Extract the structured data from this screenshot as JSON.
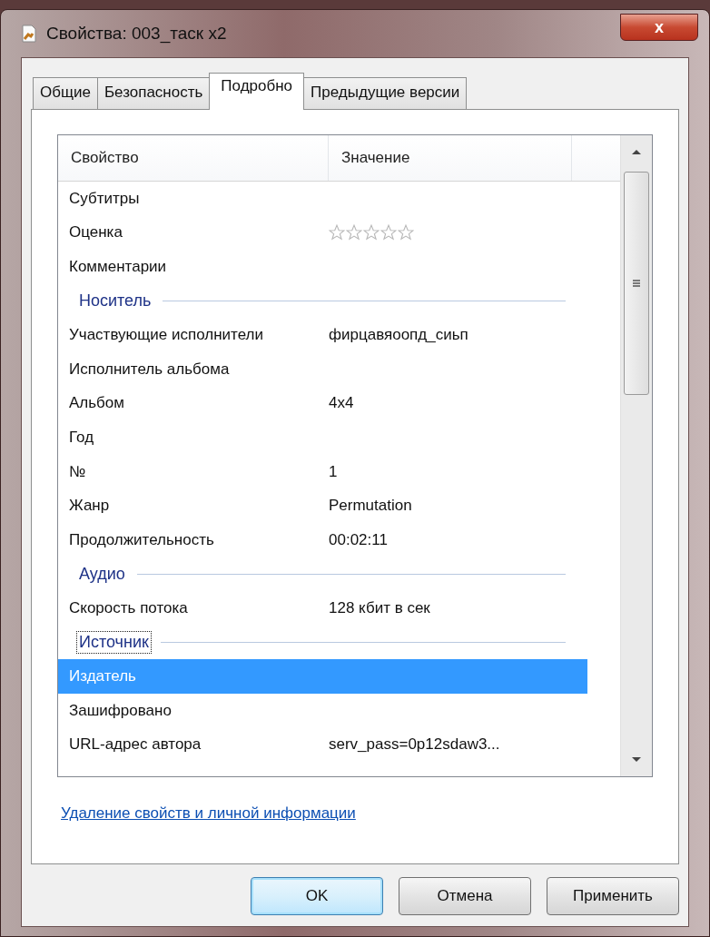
{
  "window": {
    "title": "Свойства: 003_таск x2",
    "close": "x"
  },
  "tabs": [
    {
      "label": "Общие",
      "selected": false
    },
    {
      "label": "Безопасность",
      "selected": false
    },
    {
      "label": "Подробно",
      "selected": true
    },
    {
      "label": "Предыдущие версии",
      "selected": false
    }
  ],
  "table": {
    "columns": [
      "Свойство",
      "Значение"
    ],
    "rows": [
      {
        "kind": "property",
        "name": "Субтитры",
        "selected": false
      },
      {
        "kind": "property",
        "name": "Оценка",
        "stars": 0,
        "selected": false
      },
      {
        "kind": "property",
        "name": "Комментарии",
        "selected": false
      },
      {
        "kind": "group",
        "label": "Носитель",
        "focused": false
      },
      {
        "kind": "property",
        "name": "Участвующие исполнители",
        "value": "фирцавяоопд_сиьп",
        "selected": false
      },
      {
        "kind": "property",
        "name": "Исполнитель альбома",
        "selected": false
      },
      {
        "kind": "property",
        "name": "Альбом",
        "value": "4x4",
        "selected": false
      },
      {
        "kind": "property",
        "name": "Год",
        "selected": false
      },
      {
        "kind": "property",
        "name": "№",
        "value": "1",
        "selected": false
      },
      {
        "kind": "property",
        "name": "Жанр",
        "value": "Permutation",
        "selected": false
      },
      {
        "kind": "property",
        "name": "Продолжительность",
        "value": "00:02:11",
        "selected": false
      },
      {
        "kind": "group",
        "label": "Аудио",
        "focused": false
      },
      {
        "kind": "property",
        "name": "Скорость потока",
        "value": "128 кбит в сек",
        "selected": false
      },
      {
        "kind": "group",
        "label": "Источник",
        "focused": true
      },
      {
        "kind": "property",
        "name": "Издатель",
        "selected": true
      },
      {
        "kind": "property",
        "name": "Зашифровано",
        "selected": false
      },
      {
        "kind": "property",
        "name": "URL-адрес автора",
        "value": "serv_pass=0p12sdaw3...",
        "selected": false
      }
    ]
  },
  "link": "Удаление свойств и личной информации",
  "buttons": [
    {
      "label": "OK",
      "default": true
    },
    {
      "label": "Отмена",
      "default": false
    },
    {
      "label": "Применить",
      "default": false
    }
  ]
}
